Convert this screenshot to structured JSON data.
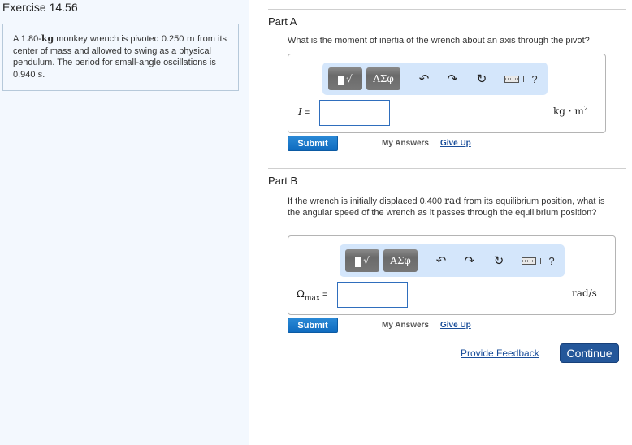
{
  "exercise": {
    "title": "Exercise 14.56",
    "problem": {
      "part1": "A 1.80-",
      "unit1": "kg",
      "part2": " monkey wrench is pivoted 0.250 ",
      "unit2": "m",
      "part3": " from its center of mass and allowed to swing as a physical pendulum. The period for small-angle oscillations is 0.940 ",
      "unit3": "s",
      "part4": "."
    }
  },
  "toolbar": {
    "templates_label": "√",
    "symbols_label": "ΑΣφ",
    "undo_icon": "↶",
    "redo_icon": "↷",
    "reset_icon": "↻",
    "help_label": "?"
  },
  "partA": {
    "title": "Part A",
    "question": "What is the moment of inertia of the wrench about an axis through the pivot?",
    "variable": "I",
    "equals": " =",
    "input_value": "",
    "unit_base": "kg · m",
    "unit_exp": "2",
    "submit_label": "Submit",
    "my_answers_label": "My Answers",
    "give_up_label": "Give Up"
  },
  "partB": {
    "title": "Part B",
    "question_part1": "If the wrench is initially displaced 0.400 ",
    "question_unit": "rad",
    "question_part2": " from its equilibrium position, what is the angular speed of the wrench as it passes through the equilibrium position?",
    "variable": "Ω",
    "variable_sub": "max",
    "equals": " =",
    "input_value": "",
    "unit": "rad/s",
    "submit_label": "Submit",
    "my_answers_label": "My Answers",
    "give_up_label": "Give Up"
  },
  "footer": {
    "feedback_label": "Provide Feedback",
    "continue_label": "Continue"
  }
}
